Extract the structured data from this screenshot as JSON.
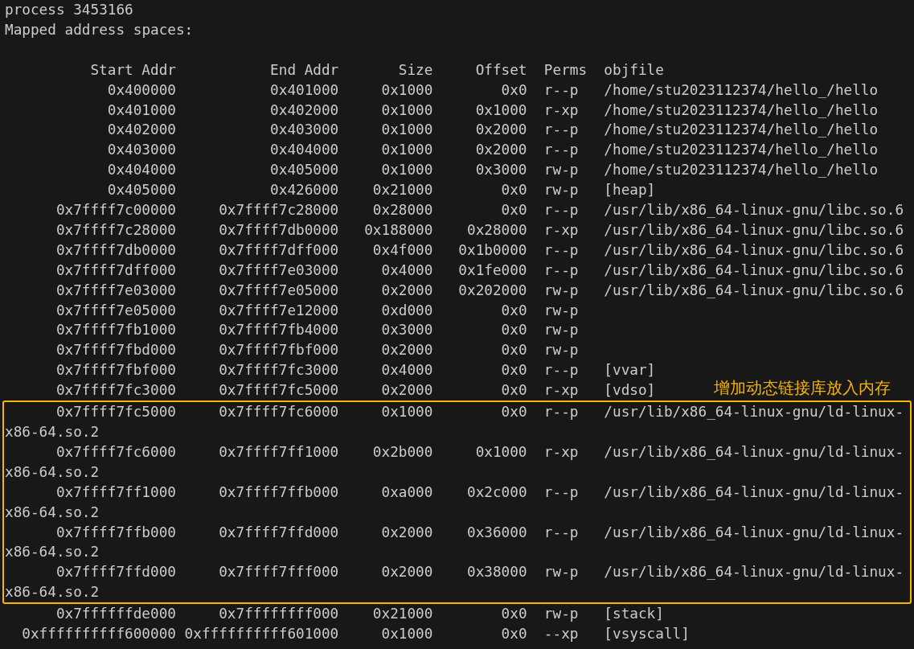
{
  "header_lines": [
    "process 3453166",
    "Mapped address spaces:"
  ],
  "columns": [
    "Start Addr",
    "End Addr",
    "Size",
    "Offset",
    "Perms",
    "objfile"
  ],
  "rows": [
    {
      "start": "0x400000",
      "end": "0x401000",
      "size": "0x1000",
      "offset": "0x0",
      "perms": "r--p",
      "objfile": "/home/stu2023112374/hello_/hello"
    },
    {
      "start": "0x401000",
      "end": "0x402000",
      "size": "0x1000",
      "offset": "0x1000",
      "perms": "r-xp",
      "objfile": "/home/stu2023112374/hello_/hello"
    },
    {
      "start": "0x402000",
      "end": "0x403000",
      "size": "0x1000",
      "offset": "0x2000",
      "perms": "r--p",
      "objfile": "/home/stu2023112374/hello_/hello"
    },
    {
      "start": "0x403000",
      "end": "0x404000",
      "size": "0x1000",
      "offset": "0x2000",
      "perms": "r--p",
      "objfile": "/home/stu2023112374/hello_/hello"
    },
    {
      "start": "0x404000",
      "end": "0x405000",
      "size": "0x1000",
      "offset": "0x3000",
      "perms": "rw-p",
      "objfile": "/home/stu2023112374/hello_/hello"
    },
    {
      "start": "0x405000",
      "end": "0x426000",
      "size": "0x21000",
      "offset": "0x0",
      "perms": "rw-p",
      "objfile": "[heap]"
    },
    {
      "start": "0x7ffff7c00000",
      "end": "0x7ffff7c28000",
      "size": "0x28000",
      "offset": "0x0",
      "perms": "r--p",
      "objfile": "/usr/lib/x86_64-linux-gnu/libc.so.6"
    },
    {
      "start": "0x7ffff7c28000",
      "end": "0x7ffff7db0000",
      "size": "0x188000",
      "offset": "0x28000",
      "perms": "r-xp",
      "objfile": "/usr/lib/x86_64-linux-gnu/libc.so.6"
    },
    {
      "start": "0x7ffff7db0000",
      "end": "0x7ffff7dff000",
      "size": "0x4f000",
      "offset": "0x1b0000",
      "perms": "r--p",
      "objfile": "/usr/lib/x86_64-linux-gnu/libc.so.6"
    },
    {
      "start": "0x7ffff7dff000",
      "end": "0x7ffff7e03000",
      "size": "0x4000",
      "offset": "0x1fe000",
      "perms": "r--p",
      "objfile": "/usr/lib/x86_64-linux-gnu/libc.so.6"
    },
    {
      "start": "0x7ffff7e03000",
      "end": "0x7ffff7e05000",
      "size": "0x2000",
      "offset": "0x202000",
      "perms": "rw-p",
      "objfile": "/usr/lib/x86_64-linux-gnu/libc.so.6"
    },
    {
      "start": "0x7ffff7e05000",
      "end": "0x7ffff7e12000",
      "size": "0xd000",
      "offset": "0x0",
      "perms": "rw-p"
    },
    {
      "start": "0x7ffff7fb1000",
      "end": "0x7ffff7fb4000",
      "size": "0x3000",
      "offset": "0x0",
      "perms": "rw-p"
    },
    {
      "start": "0x7ffff7fbd000",
      "end": "0x7ffff7fbf000",
      "size": "0x2000",
      "offset": "0x0",
      "perms": "rw-p"
    },
    {
      "start": "0x7ffff7fbf000",
      "end": "0x7ffff7fc3000",
      "size": "0x4000",
      "offset": "0x0",
      "perms": "r--p",
      "objfile": "[vvar]"
    },
    {
      "start": "0x7ffff7fc3000",
      "end": "0x7ffff7fc5000",
      "size": "0x2000",
      "offset": "0x0",
      "perms": "r-xp",
      "objfile": "[vdso]"
    }
  ],
  "highlight": {
    "label": "增加动态链接库放入内存",
    "rows": [
      {
        "start": "0x7ffff7fc5000",
        "end": "0x7ffff7fc6000",
        "size": "0x1000",
        "offset": "0x0",
        "perms": "r--p",
        "objfile": "/usr/lib/x86_64-linux-gnu/ld-linux-x86-64.so.2"
      },
      {
        "start": "0x7ffff7fc6000",
        "end": "0x7ffff7ff1000",
        "size": "0x2b000",
        "offset": "0x1000",
        "perms": "r-xp",
        "objfile": "/usr/lib/x86_64-linux-gnu/ld-linux-x86-64.so.2"
      },
      {
        "start": "0x7ffff7ff1000",
        "end": "0x7ffff7ffb000",
        "size": "0xa000",
        "offset": "0x2c000",
        "perms": "r--p",
        "objfile": "/usr/lib/x86_64-linux-gnu/ld-linux-x86-64.so.2"
      },
      {
        "start": "0x7ffff7ffb000",
        "end": "0x7ffff7ffd000",
        "size": "0x2000",
        "offset": "0x36000",
        "perms": "r--p",
        "objfile": "/usr/lib/x86_64-linux-gnu/ld-linux-x86-64.so.2"
      },
      {
        "start": "0x7ffff7ffd000",
        "end": "0x7ffff7fff000",
        "size": "0x2000",
        "offset": "0x38000",
        "perms": "rw-p",
        "objfile": "/usr/lib/x86_64-linux-gnu/ld-linux-x86-64.so.2"
      }
    ]
  },
  "rows_after": [
    {
      "start": "0x7ffffffde000",
      "end": "0x7ffffffff000",
      "size": "0x21000",
      "offset": "0x0",
      "perms": "rw-p",
      "objfile": "[stack]"
    },
    {
      "start": "0xffffffffff600000",
      "end": "0xffffffffff601000",
      "size": "0x1000",
      "offset": "0x0",
      "perms": "--xp",
      "objfile": "[vsyscall]"
    }
  ]
}
